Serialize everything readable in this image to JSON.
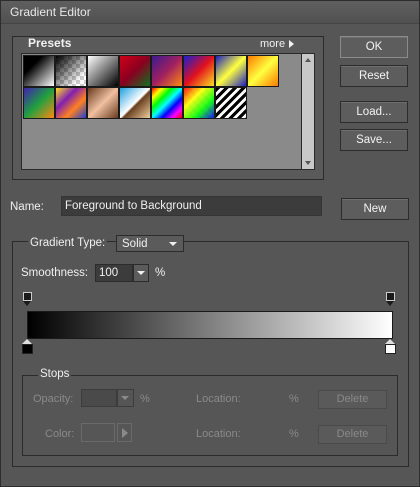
{
  "window": {
    "title": "Gradient Editor"
  },
  "presets": {
    "label": "Presets",
    "more_label": "more",
    "swatches_row1": [
      "foreground-to-background",
      "foreground-to-transparent",
      "black-white",
      "red-green",
      "violet-orange",
      "blue-red-yellow",
      "blue-yellow-blue",
      "orange-yellow-orange"
    ],
    "swatches_row2": [
      "violet-green-orange",
      "yellow-violet-orange-blue",
      "copper",
      "chrome",
      "spectrum",
      "transparent-rainbow",
      "transparent-stripes"
    ]
  },
  "buttons": {
    "ok": "OK",
    "reset": "Reset",
    "load": "Load...",
    "save": "Save...",
    "new": "New"
  },
  "name": {
    "label": "Name:",
    "value": "Foreground to Background"
  },
  "gradient": {
    "type_label": "Gradient Type:",
    "type_value": "Solid",
    "smoothness_label": "Smoothness:",
    "smoothness_value": "100",
    "smoothness_unit": "%",
    "start_color": "#000000",
    "end_color": "#ffffff"
  },
  "stops": {
    "label": "Stops",
    "opacity_label": "Opacity:",
    "opacity_unit": "%",
    "location_label": "Location:",
    "location_unit": "%",
    "delete_label": "Delete",
    "color_label": "Color:"
  },
  "colors": {
    "accent_border": "#8b8b8b",
    "background": "#565656"
  }
}
